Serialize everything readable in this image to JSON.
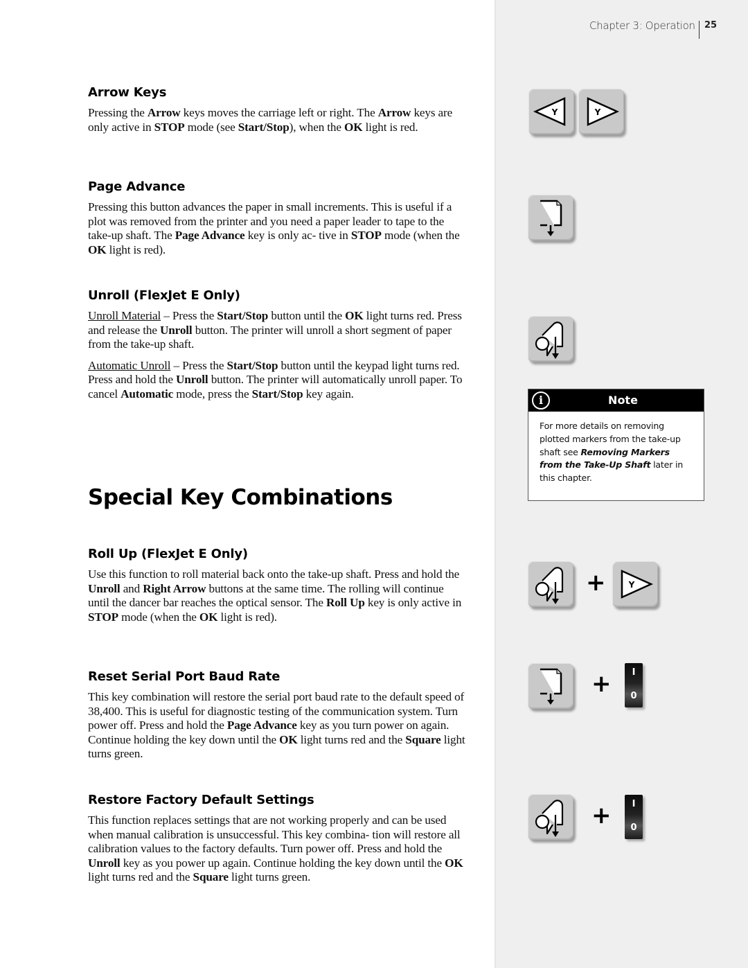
{
  "header": {
    "chapter": "Chapter 3: Operation",
    "page_number": "25"
  },
  "sections": {
    "arrow_keys": {
      "title": "Arrow Keys",
      "p1": [
        {
          "t": "Pressing the "
        },
        {
          "b": "Arrow"
        },
        {
          "t": " keys moves the carriage left or right. The "
        },
        {
          "b": "Arrow"
        },
        {
          "t": " keys are only active in "
        },
        {
          "b": "STOP"
        },
        {
          "t": " mode (see "
        },
        {
          "b": "Start/Stop"
        },
        {
          "t": "), when the "
        },
        {
          "b": "OK"
        },
        {
          "t": " light is red."
        }
      ]
    },
    "page_advance": {
      "title": "Page Advance",
      "p1": [
        {
          "t": "Pressing this button advances the paper in small increments. This is useful if a plot was removed from the printer and you need a paper leader to tape to the take-up shaft. The "
        },
        {
          "b": "Page Advance"
        },
        {
          "t": " key is only ac- tive in "
        },
        {
          "b": "STOP"
        },
        {
          "t": " mode (when the "
        },
        {
          "b": "OK"
        },
        {
          "t": " light is red)."
        }
      ]
    },
    "unroll": {
      "title": "Unroll (FlexJet E Only)",
      "p1": [
        {
          "u": "Unroll Material"
        },
        {
          "t": " – Press the "
        },
        {
          "b": "Start/Stop"
        },
        {
          "t": " button until the "
        },
        {
          "b": "OK"
        },
        {
          "t": " light turns red. Press and release the "
        },
        {
          "b": "Unroll"
        },
        {
          "t": " button. The printer will unroll a short segment of paper from the take-up shaft."
        }
      ],
      "p2": [
        {
          "u": "Automatic Unroll"
        },
        {
          "t": " – Press the "
        },
        {
          "b": "Start/Stop"
        },
        {
          "t": " button until the keypad light turns red. Press and hold the "
        },
        {
          "b": "Unroll"
        },
        {
          "t": " button. The printer will automatically unroll paper. To cancel "
        },
        {
          "b": "Automatic"
        },
        {
          "t": " mode, press the "
        },
        {
          "b": "Start/Stop"
        },
        {
          "t": " key again."
        }
      ]
    },
    "special_title": "Special Key Combinations",
    "roll_up": {
      "title": "Roll Up (FlexJet E Only)",
      "p1": [
        {
          "t": "Use this function to roll material back onto the take-up shaft. Press and hold the "
        },
        {
          "b": "Unroll"
        },
        {
          "t": " and "
        },
        {
          "b": "Right Arrow"
        },
        {
          "t": " buttons at the same time. The rolling will continue until the dancer bar reaches the optical sensor. The "
        },
        {
          "b": "Roll Up"
        },
        {
          "t": " key is only active in "
        },
        {
          "b": "STOP"
        },
        {
          "t": " mode (when the "
        },
        {
          "b": "OK"
        },
        {
          "t": " light is red)."
        }
      ]
    },
    "reset_baud": {
      "title": "Reset Serial Port Baud Rate",
      "p1": [
        {
          "t": "This key combination will restore the serial port baud rate to the default speed of 38,400. This is useful for diagnostic testing of the communication system. Turn power off. Press and hold the "
        },
        {
          "b": "Page Advance"
        },
        {
          "t": " key as you turn power on again. Continue holding the key down until the "
        },
        {
          "b": "OK"
        },
        {
          "t": " light turns red and the "
        },
        {
          "b": "Square"
        },
        {
          "t": " light turns green."
        }
      ]
    },
    "restore_defaults": {
      "title": "Restore Factory Default Settings",
      "p1": [
        {
          "t": "This function replaces settings that are not working properly and can be used when manual calibration is unsuccessful. This key combina- tion will restore all calibration values to the factory defaults. Turn power off. Press and hold the "
        },
        {
          "b": "Unroll"
        },
        {
          "t": " key as you power up again. Continue holding the key down until the "
        },
        {
          "b": "OK"
        },
        {
          "t": " light turns red and the "
        },
        {
          "b": "Square"
        },
        {
          "t": " light turns green."
        }
      ]
    }
  },
  "note": {
    "icon": "info-icon",
    "title": "Note",
    "body": [
      {
        "t": "For more details on removing plotted markers from the take-up shaft see "
      },
      {
        "i": "Removing Markers from the Take-Up Shaft"
      },
      {
        "t": " later in this chapter."
      }
    ]
  },
  "keys": {
    "arrow_label": "Y",
    "plus": "+",
    "power_on": "I",
    "power_off": "0",
    "icons": [
      "left-arrow-key-icon",
      "right-arrow-key-icon",
      "page-advance-key-icon",
      "unroll-key-icon",
      "power-switch-icon"
    ]
  }
}
